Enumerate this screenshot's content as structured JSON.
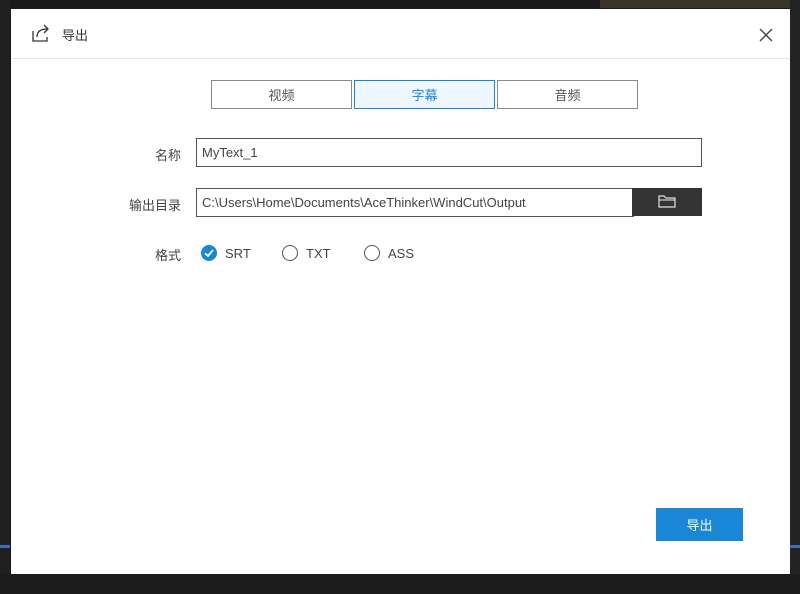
{
  "dialog": {
    "title": "导出",
    "title_icon": "export-icon",
    "close_icon": "close-icon"
  },
  "tabs": [
    {
      "label": "视频",
      "active": false
    },
    {
      "label": "字幕",
      "active": true
    },
    {
      "label": "音频",
      "active": false
    }
  ],
  "form": {
    "name_label": "名称",
    "name_value": "MyText_1",
    "output_label": "输出目录",
    "output_value": "C:\\Users\\Home\\Documents\\AceThinker\\WindCut\\Output",
    "browse_icon": "folder-icon",
    "format_label": "格式",
    "formats": [
      {
        "label": "SRT",
        "checked": true
      },
      {
        "label": "TXT",
        "checked": false
      },
      {
        "label": "ASS",
        "checked": false
      }
    ]
  },
  "footer": {
    "export_label": "导出"
  },
  "colors": {
    "accent": "#1a86d6",
    "dark_button": "#333333",
    "border": "#555555"
  }
}
